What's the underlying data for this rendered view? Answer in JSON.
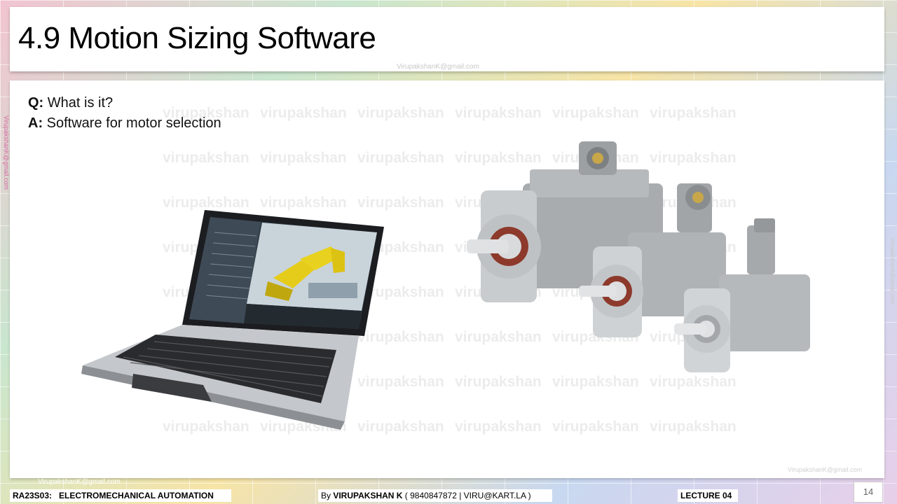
{
  "slide": {
    "title": "4.9 Motion Sizing Software",
    "page_number": "14"
  },
  "qa": {
    "q_prefix": "Q:",
    "q_text": " What is it?",
    "a_prefix": "A:",
    "a_text": " Software for motor selection"
  },
  "watermarks": {
    "word": "virupakshan",
    "email_center": "VirupakshanK@gmail.com",
    "email_left": "VirupakshanK@gmail.com",
    "email_right": "VirupakshanK@gmail.com",
    "email_corner": "VirupakshanK@gmail.com",
    "email_footer": "VirupakshanK@gmail.com"
  },
  "images": {
    "laptop": "laptop-with-cad-software-image",
    "motors": "servo-motors-image"
  },
  "footer": {
    "course_code": "RA23S03:",
    "course_name": "ELECTROMECHANICAL AUTOMATION",
    "author_prefix": "By ",
    "author_name": "VIRUPAKSHAN K",
    "author_contact": " ( 9840847872 | VIRU@KART.LA )",
    "lecture": "LECTURE 04"
  }
}
